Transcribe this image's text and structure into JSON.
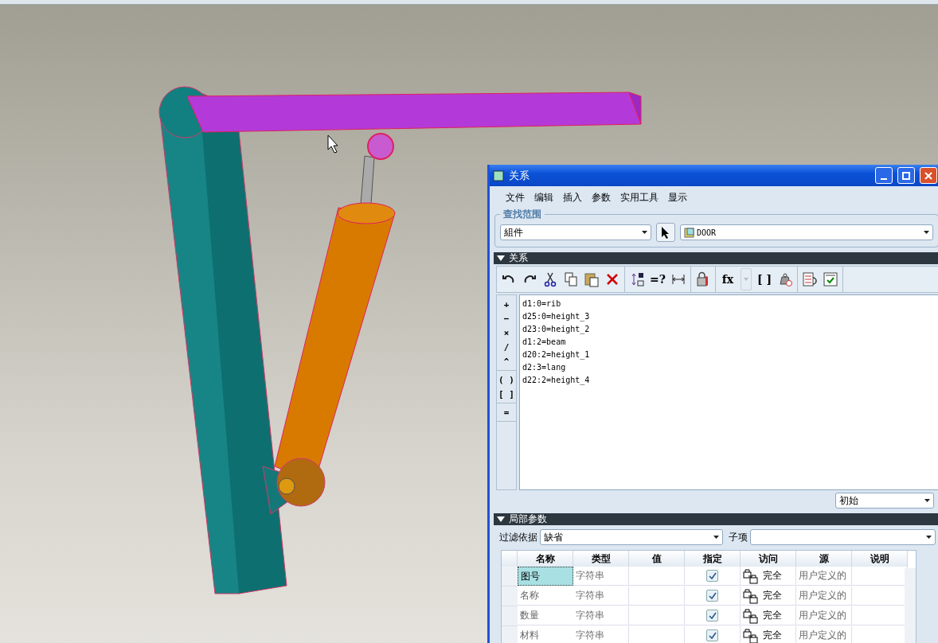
{
  "window": {
    "title": "关系"
  },
  "menu": [
    "文件",
    "编辑",
    "插入",
    "参数",
    "实用工具",
    "显示"
  ],
  "search_scope": {
    "label": "查找范围",
    "scope": "組件",
    "model": "DOOR"
  },
  "relations": {
    "title": "关系",
    "expanded": true,
    "toolbar": [
      [
        {
          "kind": "undo"
        },
        {
          "kind": "redo"
        },
        {
          "kind": "cut"
        },
        {
          "kind": "copy"
        },
        {
          "kind": "paste"
        },
        {
          "kind": "delete"
        }
      ],
      [
        {
          "kind": "switch"
        },
        {
          "kind": "text",
          "label": "=?"
        },
        {
          "kind": "measure"
        }
      ],
      [
        {
          "kind": "lock"
        }
      ],
      [
        {
          "kind": "text",
          "label": "fx"
        },
        {
          "kind": "disabled-drop"
        },
        {
          "kind": "text",
          "label": "[ ]"
        },
        {
          "kind": "weight"
        }
      ],
      [
        {
          "kind": "list"
        },
        {
          "kind": "check"
        }
      ]
    ],
    "operators": [
      [
        "+",
        "−",
        "×",
        "/",
        "^"
      ],
      [
        "( )",
        "[ ]"
      ],
      [
        "="
      ]
    ],
    "lines": [
      "d1:0=rib",
      "d25:0=height_3",
      "d23:0=height_2",
      "d1:2=beam",
      "d20:2=height_1",
      "d2:3=lang",
      "d22:2=height_4"
    ],
    "mode": "初始"
  },
  "local_parameters": {
    "title": "局部参数",
    "expanded": true,
    "filter_label": "过滤依据",
    "filter_value": "缺省",
    "subitem_label": "子项",
    "columns": [
      "名称",
      "类型",
      "值",
      "指定",
      "访问",
      "源",
      "说明"
    ],
    "rows": [
      {
        "name": "图号",
        "type": "字符串",
        "designated": true,
        "access": "完全",
        "source": "用户定义的",
        "selected": true
      },
      {
        "name": "名称",
        "type": "字符串",
        "designated": true,
        "access": "完全",
        "source": "用户定义的",
        "selected": false
      },
      {
        "name": "数量",
        "type": "字符串",
        "designated": true,
        "access": "完全",
        "source": "用户定义的",
        "selected": false
      },
      {
        "name": "材料",
        "type": "字符串",
        "designated": true,
        "access": "完全",
        "source": "用户定义的",
        "selected": false
      }
    ]
  }
}
